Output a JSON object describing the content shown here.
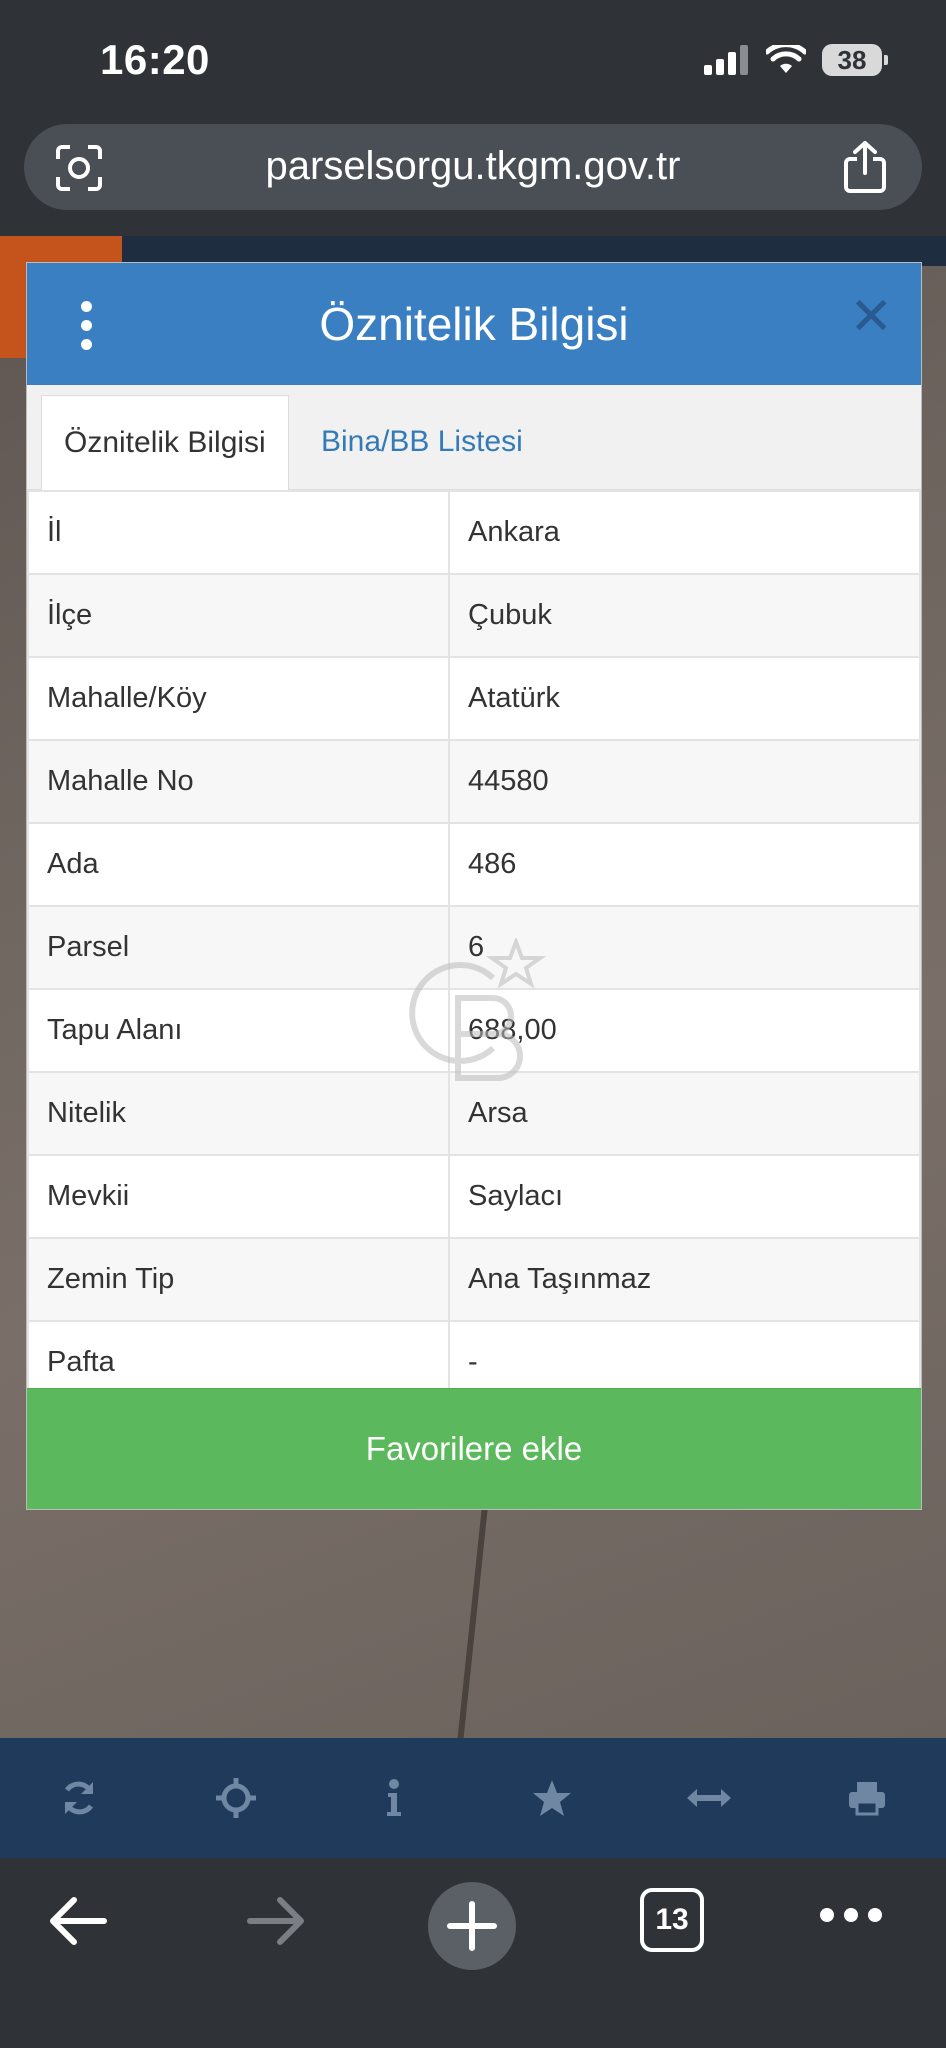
{
  "status_bar": {
    "time": "16:20",
    "battery": "38"
  },
  "url_bar": {
    "url": "parselsorgu.tkgm.gov.tr"
  },
  "modal": {
    "title": "Öznitelik Bilgisi",
    "tabs": [
      {
        "label": "Öznitelik Bilgisi",
        "active": true
      },
      {
        "label": "Bina/BB Listesi",
        "active": false
      }
    ],
    "rows": [
      {
        "key": "İl",
        "value": "Ankara"
      },
      {
        "key": "İlçe",
        "value": "Çubuk"
      },
      {
        "key": "Mahalle/Köy",
        "value": "Atatürk"
      },
      {
        "key": "Mahalle No",
        "value": "44580"
      },
      {
        "key": "Ada",
        "value": "486"
      },
      {
        "key": "Parsel",
        "value": "6"
      },
      {
        "key": "Tapu Alanı",
        "value": "688,00"
      },
      {
        "key": "Nitelik",
        "value": "Arsa"
      },
      {
        "key": "Mevkii",
        "value": "Saylacı"
      },
      {
        "key": "Zemin Tip",
        "value": "Ana Taşınmaz"
      },
      {
        "key": "Pafta",
        "value": "-"
      }
    ],
    "favorite_button": "Favorilere ekle"
  },
  "map_toolbar": {
    "icons": [
      "refresh-icon",
      "crosshair-icon",
      "info-icon",
      "star-icon",
      "measure-icon",
      "print-icon"
    ]
  },
  "browser_bar": {
    "tab_count": "13"
  },
  "colors": {
    "header_blue": "#3a7fc2",
    "button_green": "#5cb85c",
    "toolbar_navy": "#1f3a5b",
    "link_blue": "#337ab7"
  }
}
